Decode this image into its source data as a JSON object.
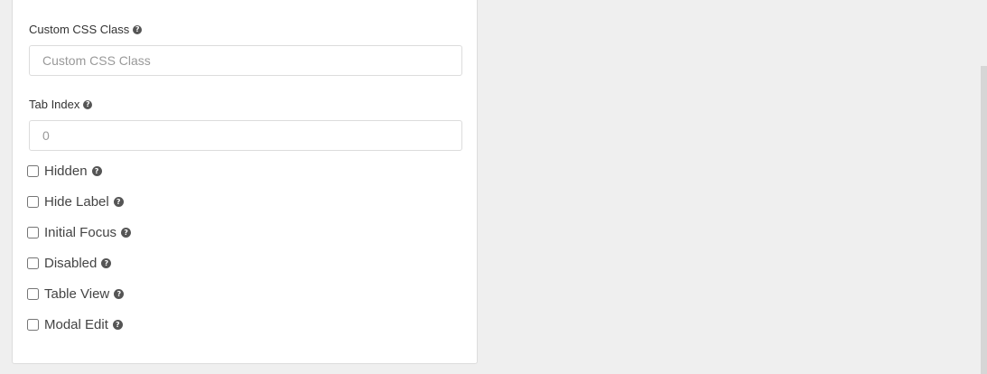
{
  "fields": {
    "css_class": {
      "label": "Custom CSS Class",
      "placeholder": "Custom CSS Class",
      "value": ""
    },
    "tab_index": {
      "label": "Tab Index",
      "placeholder": "0",
      "value": ""
    }
  },
  "checkboxes": [
    {
      "label": "Hidden",
      "checked": false
    },
    {
      "label": "Hide Label",
      "checked": false
    },
    {
      "label": "Initial Focus",
      "checked": false
    },
    {
      "label": "Disabled",
      "checked": false
    },
    {
      "label": "Table View",
      "checked": false
    },
    {
      "label": "Modal Edit",
      "checked": false
    }
  ],
  "icons": {
    "help": "question-circle-icon"
  },
  "help_glyph": "?"
}
